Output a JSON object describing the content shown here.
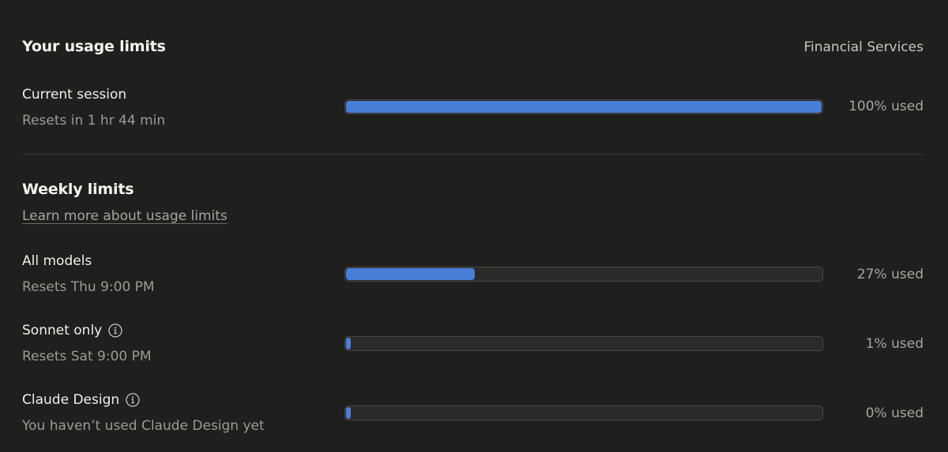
{
  "header": {
    "title": "Your usage limits",
    "plan": "Financial Services"
  },
  "current_session": {
    "label": "Current session",
    "sub": "Resets in 1 hr 44 min",
    "percent": 100,
    "value_text": "100% used"
  },
  "weekly": {
    "title": "Weekly limits",
    "learn_more": "Learn more about usage limits",
    "rows": [
      {
        "label": "All models",
        "sub": "Resets Thu 9:00 PM",
        "percent": 27,
        "value_text": "27% used",
        "has_info": false
      },
      {
        "label": "Sonnet only",
        "sub": "Resets Sat 9:00 PM",
        "percent": 1,
        "value_text": "1% used",
        "has_info": true
      },
      {
        "label": "Claude Design",
        "sub": "You haven’t used Claude Design yet",
        "percent": 0,
        "value_text": "0% used",
        "has_info": true
      }
    ]
  },
  "colors": {
    "background": "#1f1f1e",
    "bar_fill": "#4a7fd9",
    "bar_track": "#2a2a29"
  },
  "icons": {
    "info": "info-icon"
  }
}
